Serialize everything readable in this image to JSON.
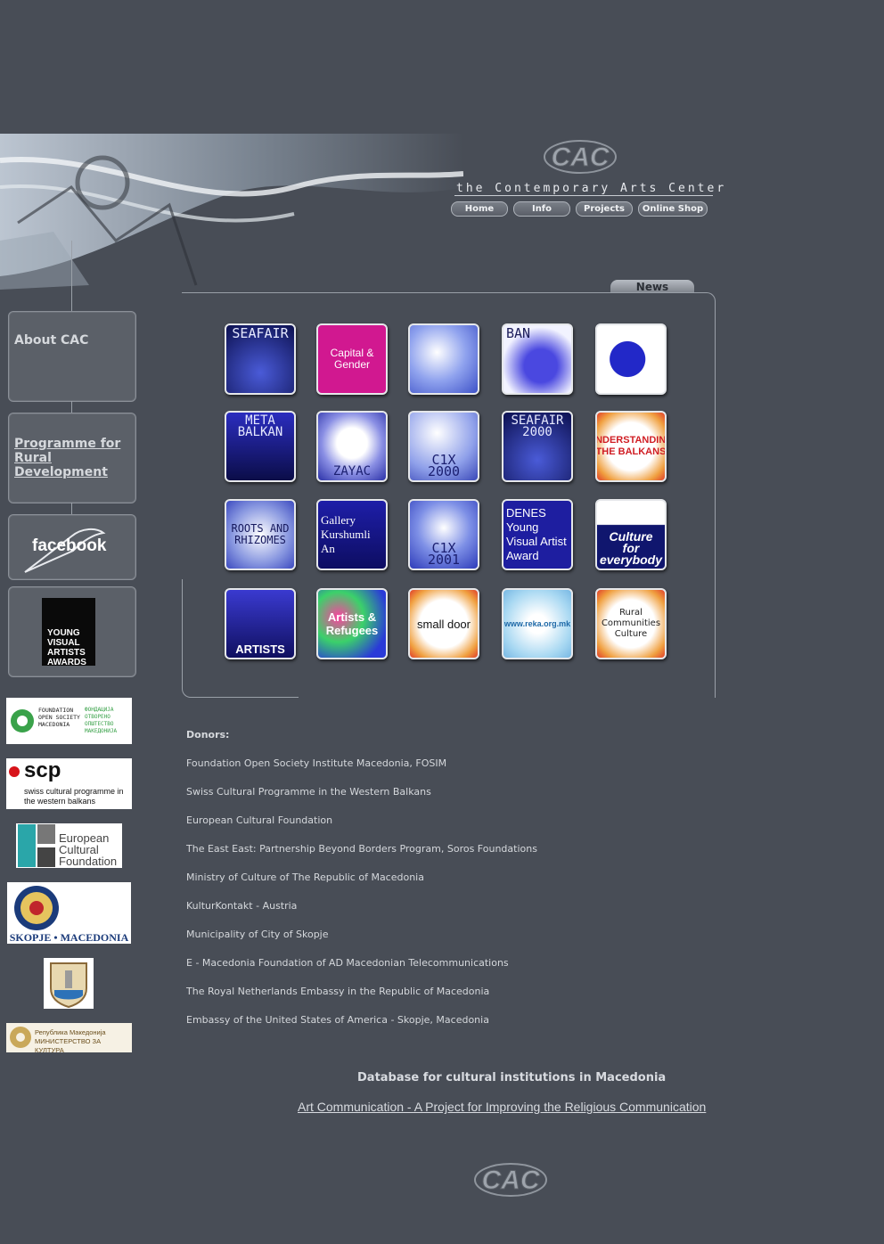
{
  "header": {
    "logo_text": "CAC",
    "tagline": "the Contemporary Arts Center",
    "nav": [
      {
        "label": "Home"
      },
      {
        "label": "Info"
      },
      {
        "label": "Projects"
      },
      {
        "label": "Online Shop"
      }
    ]
  },
  "sidebar": {
    "about_label": "About CAC",
    "rural_link": "Programme for Rural Development",
    "facebook_label": "facebook",
    "yvaa_label": "YOUNG VISUAL ARTISTS AWARDS"
  },
  "news": {
    "tab_label": "News",
    "tiles": [
      {
        "label": "SEAFAIR"
      },
      {
        "label": "Capital & Gender"
      },
      {
        "label": ""
      },
      {
        "label": "BAN"
      },
      {
        "label": ""
      },
      {
        "label": "META BALKAN"
      },
      {
        "label": "ZAYAC"
      },
      {
        "label": "C1X 2000"
      },
      {
        "label": "SEAFAIR 2000"
      },
      {
        "label": "UNDERSTANDING THE BALKANS"
      },
      {
        "label": "ROOTS AND RHIZOMES"
      },
      {
        "label": "Gallery Kurshumli An"
      },
      {
        "label": "C1X 2001"
      },
      {
        "label": "DENES Young Visual Artist Award"
      },
      {
        "label": "Culture for everybody"
      },
      {
        "label": "ARTISTS"
      },
      {
        "label": "Artists & Refugees"
      },
      {
        "label": "small door"
      },
      {
        "label": "www.reka.org.mk"
      },
      {
        "label": "Rural Communities Culture"
      }
    ]
  },
  "sponsor_logos": {
    "fosim": "FOUNDATION OPEN SOCIETY MACEDONIA",
    "fosim_mk": "ФОНДАЦИЈА ОТВОРЕНО ОПШТЕСТВО МАКЕДОНИЈА",
    "scp": "scp",
    "scp_sub": "swiss cultural programme in the western balkans",
    "ecf": "European Cultural Foundation",
    "usa": "SKOPJE • MACEDONIA",
    "ministry": "Република Македонија МИНИСТЕРСТВО ЗА КУЛТУРА"
  },
  "donors": {
    "title": "Donors:",
    "items": [
      "Foundation Open Society Institute Macedonia, FOSIM",
      "Swiss Cultural Programme in the Western Balkans",
      "European Cultural Foundation",
      "The East East: Partnership Beyond Borders Program, Soros Foundations",
      "Ministry of Culture of The Republic of Macedonia",
      "KulturKontakt - Austria",
      "Municipality of City of Skopje",
      "E - Macedonia Foundation of AD Macedonian Telecommunications",
      "The Royal Netherlands Embassy in the Republic of Macedonia",
      "Embassy of the United States of America - Skopje, Macedonia"
    ]
  },
  "footer": {
    "database_link": "Database for cultural institutions in Macedonia",
    "art_link": "Art Communication - A Project for Improving the Religious Communication",
    "logo_text": "CAC"
  }
}
